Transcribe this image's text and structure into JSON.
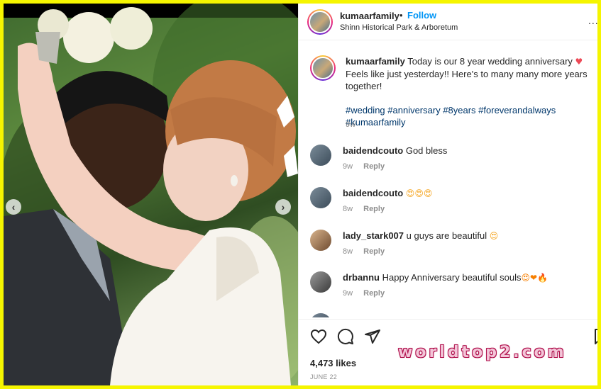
{
  "post": {
    "username": "kumaarfamily",
    "separator": "•",
    "follow_label": "Follow",
    "location": "Shinn Historical Park & Arboretum",
    "more_label": "...",
    "caption_text": "Today is our 8 year wedding anniversary",
    "caption_text_2": "Feels like just yesterday!! Here's to many many more years together!",
    "hashtags": "#wedding #anniversary #8years #foreverandalways #kumaarfamily",
    "caption_age": "9w",
    "likes": "4,473 likes",
    "date": "JUNE 22"
  },
  "comments": [
    {
      "user": "baidendcouto",
      "text": "God bless",
      "emoji": "",
      "age": "9w",
      "reply": "Reply"
    },
    {
      "user": "baidendcouto",
      "text": "",
      "emoji": "😍😍😍",
      "age": "8w",
      "reply": "Reply"
    },
    {
      "user": "lady_stark007",
      "text": "u guys are beautiful",
      "emoji": "😍",
      "age": "8w",
      "reply": "Reply"
    },
    {
      "user": "drbannu",
      "text": "Happy Anniversary beautiful souls",
      "emoji": "😍❤🔥",
      "age": "9w",
      "reply": "Reply"
    }
  ],
  "icons": {
    "like": "heart-outline-icon",
    "comment": "comment-bubble-icon",
    "share": "paper-plane-icon",
    "save": "bookmark-icon",
    "prev": "chevron-left-icon",
    "next": "chevron-right-icon"
  },
  "carousel": {
    "prev": "‹",
    "next": "›"
  },
  "watermark": "worldtop2.com",
  "colors": {
    "frame": "#f5f500",
    "follow": "#0095f6",
    "hashtag": "#00376b",
    "muted": "#8e8e8e",
    "heart": "#ed4956"
  }
}
